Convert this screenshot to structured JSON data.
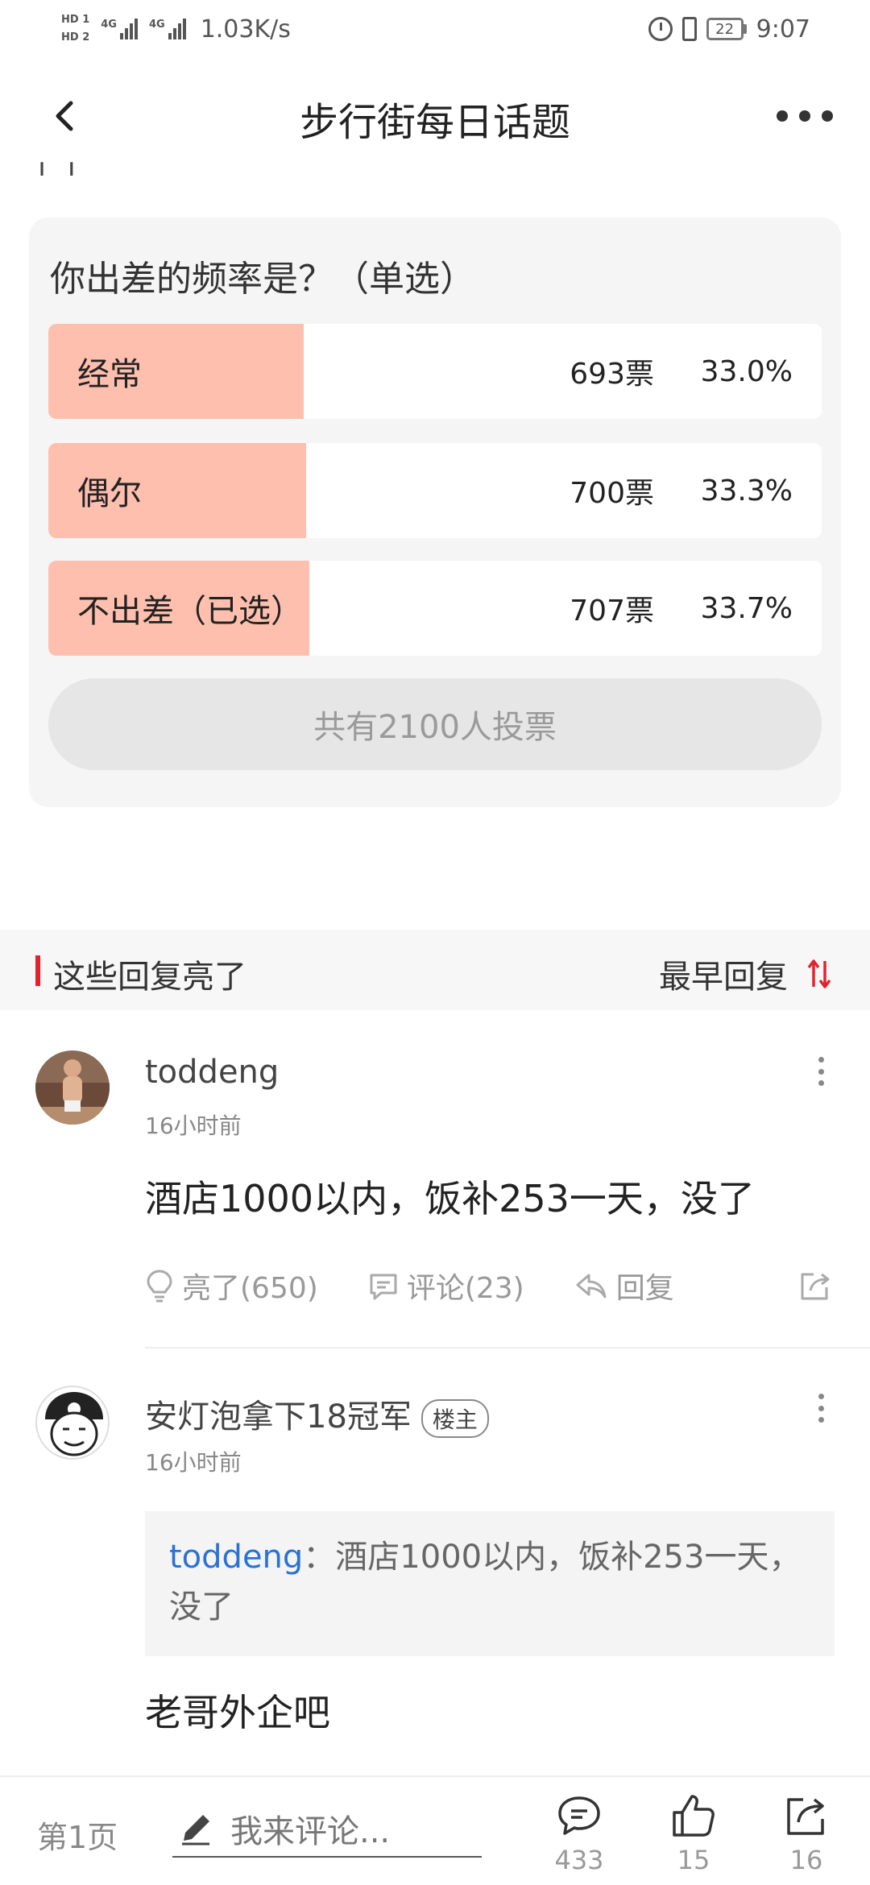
{
  "status_bar": {
    "hd1": "HD 1",
    "hd2": "HD 2",
    "net1": "4G",
    "net2": "4G",
    "speed": "1.03K/s",
    "battery": "22",
    "time": "9:07"
  },
  "nav": {
    "title": "步行街每日话题",
    "back_icon": "chevron-left-icon",
    "more_icon": "more-dots-icon"
  },
  "poll": {
    "question": "你出差的频率是？（单选）",
    "options": [
      {
        "label": "经常",
        "votes": "693票",
        "percent": "33.0%",
        "fraction": 0.33
      },
      {
        "label": "偶尔",
        "votes": "700票",
        "percent": "33.3%",
        "fraction": 0.333
      },
      {
        "label": "不出差（已选）",
        "votes": "707票",
        "percent": "33.7%",
        "fraction": 0.337
      }
    ],
    "total": "共有2100人投票",
    "fill_color": "#ffbfae"
  },
  "section": {
    "title": "这些回复亮了",
    "sort_label": "最早回复",
    "accent": "#e2232e"
  },
  "comments": [
    {
      "user": "toddeng",
      "time": "16小时前",
      "text": "酒店1000以内，饭补253一天，没了",
      "like": "亮了(650)",
      "reply_count": "评论(23)",
      "reply": "回复"
    },
    {
      "user": "安灯泡拿下18冠军",
      "badge": "楼主",
      "time": "16小时前",
      "quote_user": "toddeng",
      "quote_text": "：酒店1000以内，饭补253一天，没了",
      "text": "老哥外企吧"
    }
  ],
  "bottom_bar": {
    "page": "第1页",
    "placeholder": "我来评论...",
    "comments": "433",
    "likes": "15",
    "shares": "16"
  }
}
